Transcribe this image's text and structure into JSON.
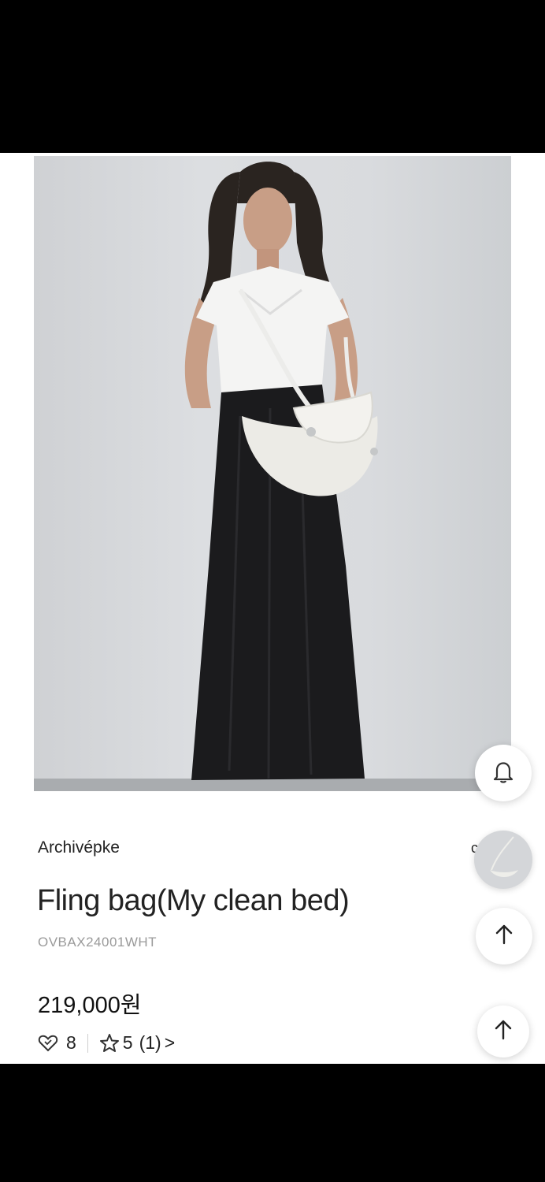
{
  "product": {
    "brand": "Archivépke",
    "title": "Fling bag(My clean bed)",
    "sku": "OVBAX24001WHT",
    "price": "219,000원",
    "likes": "8",
    "rating": "5",
    "review_count": "(1)",
    "chevron": ">"
  },
  "icons": {
    "like": "heart-icon",
    "star": "star-icon",
    "bell": "bell-icon",
    "up": "arrow-up-icon"
  },
  "partial_text": "c",
  "colors": {
    "background": "#ffffff",
    "text": "#222222",
    "sku": "#9a9a9a",
    "skirt": "#1b1b1d"
  }
}
